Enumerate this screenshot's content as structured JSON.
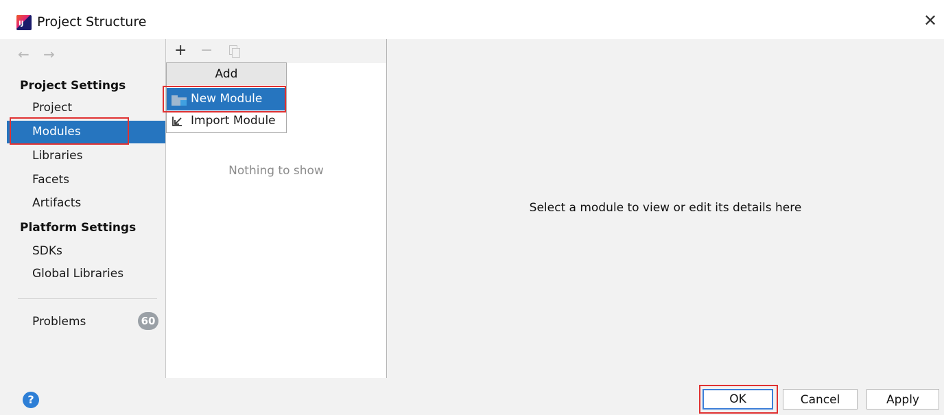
{
  "window": {
    "title": "Project Structure",
    "close_glyph": "✕",
    "app_icon": "intellij-idea-icon",
    "app_icon_text": "IJ"
  },
  "nav": {
    "back_glyph": "←",
    "forward_glyph": "→"
  },
  "sidebar": {
    "project_settings_header": "Project Settings",
    "project_items": [
      {
        "label": "Project",
        "selected": false
      },
      {
        "label": "Modules",
        "selected": true
      },
      {
        "label": "Libraries",
        "selected": false
      },
      {
        "label": "Facets",
        "selected": false
      },
      {
        "label": "Artifacts",
        "selected": false
      }
    ],
    "platform_settings_header": "Platform Settings",
    "platform_items": [
      {
        "label": "SDKs"
      },
      {
        "label": "Global Libraries"
      }
    ],
    "problems": {
      "label": "Problems",
      "count": "60"
    }
  },
  "toolbar": {
    "add_glyph": "+",
    "remove_glyph": "−",
    "copy_icon": "copy-icon"
  },
  "add_menu": {
    "header": "Add",
    "items": [
      {
        "label": "New Module",
        "icon": "folder-module-icon",
        "selected": true
      },
      {
        "label": "Import Module",
        "icon": "import-icon",
        "selected": false
      }
    ]
  },
  "middle": {
    "empty_text": "Nothing to show"
  },
  "details": {
    "placeholder": "Select a module to view or edit its details here"
  },
  "footer": {
    "help_glyph": "?",
    "ok_label": "OK",
    "cancel_label": "Cancel",
    "apply_label": "Apply"
  },
  "colors": {
    "selection": "#2675bf",
    "highlight_box": "#e03131",
    "badge": "#9aa0a6",
    "help": "#2e7fd6"
  }
}
